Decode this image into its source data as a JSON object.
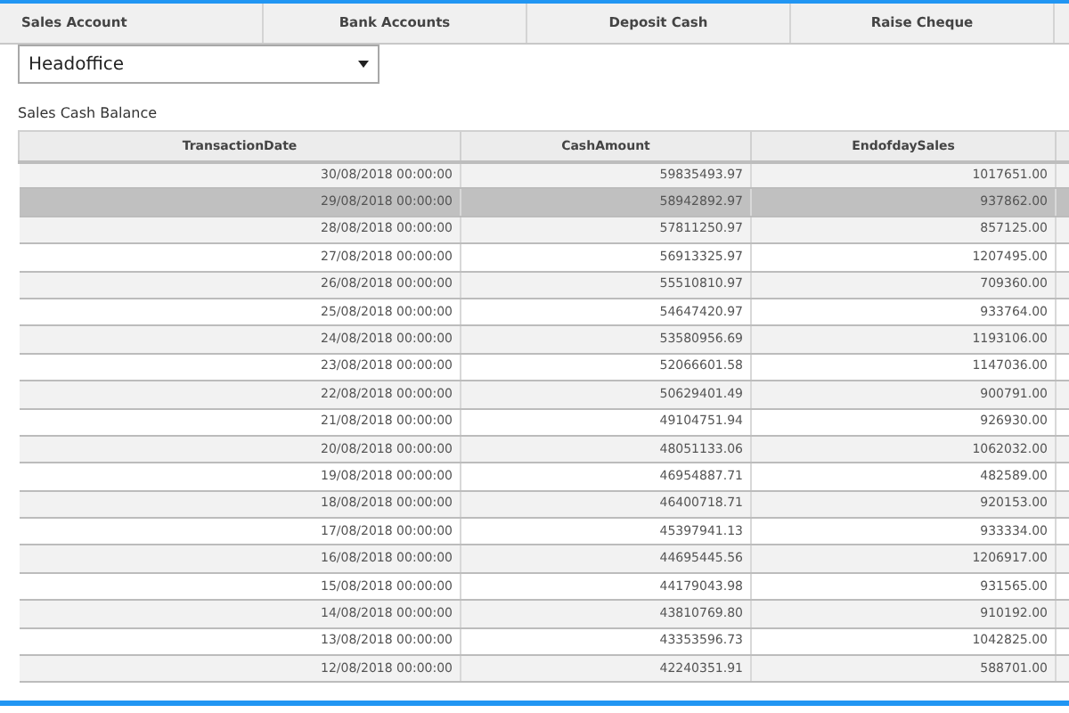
{
  "tabs": [
    {
      "label": "Sales Account"
    },
    {
      "label": "Bank Accounts"
    },
    {
      "label": "Deposit Cash"
    },
    {
      "label": "Raise Cheque"
    }
  ],
  "branch_select": {
    "value": "Headoffice"
  },
  "section_title": "Sales Cash Balance",
  "table": {
    "columns": [
      "TransactionDate",
      "CashAmount",
      "EndofdaySales"
    ],
    "rows": [
      {
        "cells": [
          "30/08/2018 00:00:00",
          "59835493.97",
          "1017651.00"
        ],
        "selected": false
      },
      {
        "cells": [
          "29/08/2018 00:00:00",
          "58942892.97",
          "937862.00"
        ],
        "selected": true
      },
      {
        "cells": [
          "28/08/2018 00:00:00",
          "57811250.97",
          "857125.00"
        ],
        "selected": false
      },
      {
        "cells": [
          "27/08/2018 00:00:00",
          "56913325.97",
          "1207495.00"
        ],
        "selected": false
      },
      {
        "cells": [
          "26/08/2018 00:00:00",
          "55510810.97",
          "709360.00"
        ],
        "selected": false
      },
      {
        "cells": [
          "25/08/2018 00:00:00",
          "54647420.97",
          "933764.00"
        ],
        "selected": false
      },
      {
        "cells": [
          "24/08/2018 00:00:00",
          "53580956.69",
          "1193106.00"
        ],
        "selected": false
      },
      {
        "cells": [
          "23/08/2018 00:00:00",
          "52066601.58",
          "1147036.00"
        ],
        "selected": false
      },
      {
        "cells": [
          "22/08/2018 00:00:00",
          "50629401.49",
          "900791.00"
        ],
        "selected": false
      },
      {
        "cells": [
          "21/08/2018 00:00:00",
          "49104751.94",
          "926930.00"
        ],
        "selected": false
      },
      {
        "cells": [
          "20/08/2018 00:00:00",
          "48051133.06",
          "1062032.00"
        ],
        "selected": false
      },
      {
        "cells": [
          "19/08/2018 00:00:00",
          "46954887.71",
          "482589.00"
        ],
        "selected": false
      },
      {
        "cells": [
          "18/08/2018 00:00:00",
          "46400718.71",
          "920153.00"
        ],
        "selected": false
      },
      {
        "cells": [
          "17/08/2018 00:00:00",
          "45397941.13",
          "933334.00"
        ],
        "selected": false
      },
      {
        "cells": [
          "16/08/2018 00:00:00",
          "44695445.56",
          "1206917.00"
        ],
        "selected": false
      },
      {
        "cells": [
          "15/08/2018 00:00:00",
          "44179043.98",
          "931565.00"
        ],
        "selected": false
      },
      {
        "cells": [
          "14/08/2018 00:00:00",
          "43810769.80",
          "910192.00"
        ],
        "selected": false
      },
      {
        "cells": [
          "13/08/2018 00:00:00",
          "43353596.73",
          "1042825.00"
        ],
        "selected": false
      },
      {
        "cells": [
          "12/08/2018 00:00:00",
          "42240351.91",
          "588701.00"
        ],
        "selected": false
      }
    ]
  }
}
